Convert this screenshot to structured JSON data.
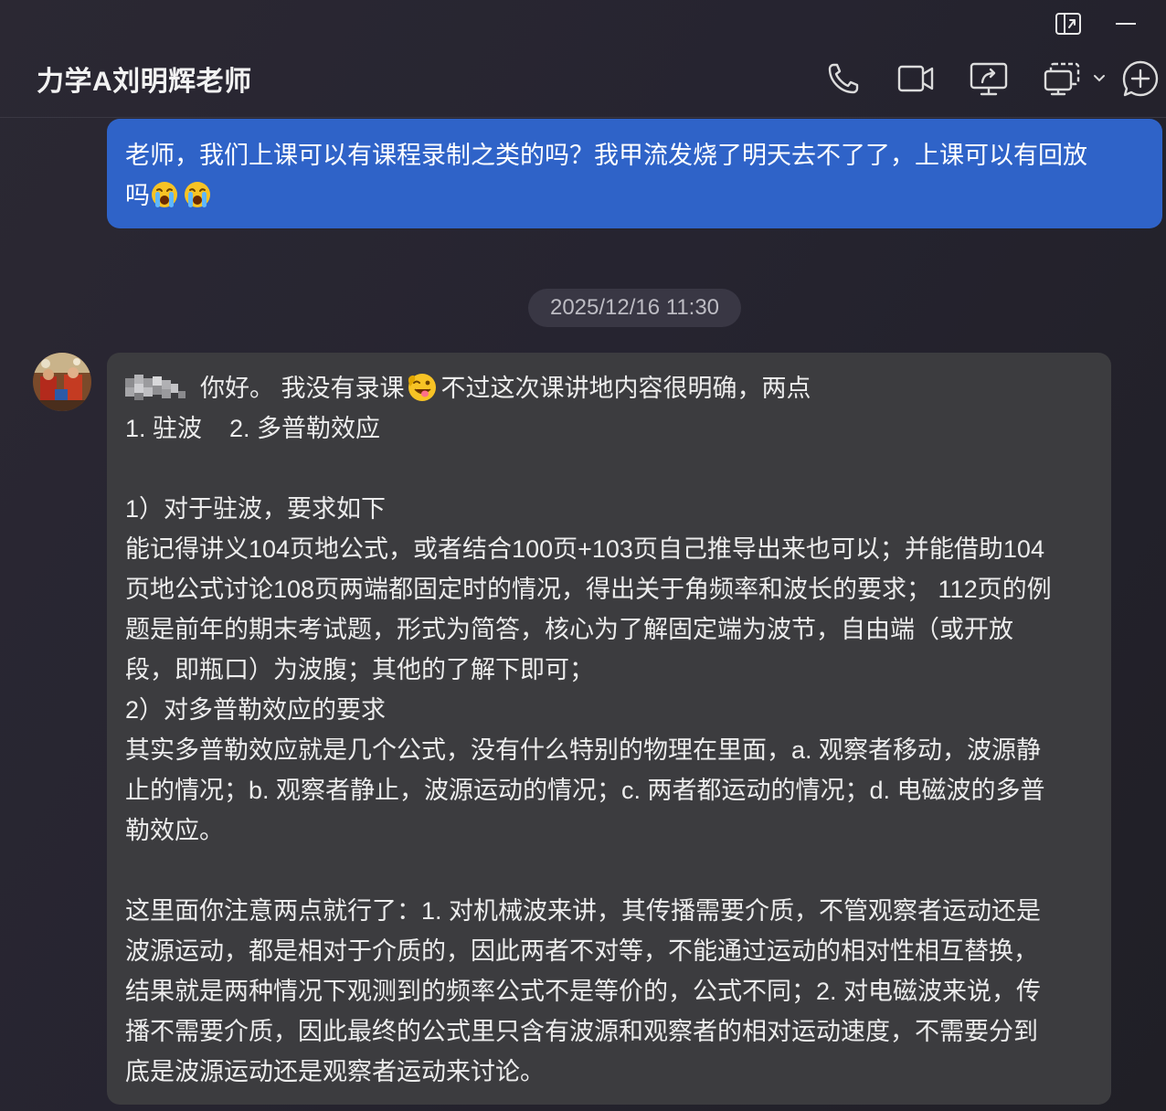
{
  "window": {
    "controls": [
      {
        "name": "pin-window-icon"
      },
      {
        "name": "minimize-icon"
      }
    ]
  },
  "header": {
    "title": "力学A刘明辉老师",
    "actions": [
      {
        "name": "voice-call-icon"
      },
      {
        "name": "video-call-icon"
      },
      {
        "name": "share-screen-icon"
      },
      {
        "name": "remote-assist-icon"
      },
      {
        "name": "chevron-down-icon"
      },
      {
        "name": "add-chat-icon"
      }
    ]
  },
  "messages": {
    "outgoing": {
      "line1": "老师，我们上课可以有课程录制之类的吗？我甲流发烧了明天去不了了，上课可以有回放",
      "line2_text": "吗",
      "emojis": [
        "loudly-crying-emoji",
        "loudly-crying-emoji"
      ]
    },
    "timestamp": "2025/12/16 11:30",
    "incoming": {
      "greeting": "你好。 我没有录课",
      "greeting_rest": "不过这次课讲地内容很明确，两点",
      "lines": [
        "1. 驻波    2. 多普勒效应",
        "",
        "1）对于驻波，要求如下",
        "能记得讲义104页地公式，或者结合100页+103页自己推导出来也可以；并能借助104",
        "页地公式讨论108页两端都固定时的情况，得出关于角频率和波长的要求； 112页的例",
        "题是前年的期末考试题，形式为简答，核心为了解固定端为波节，自由端（或开放",
        "段，即瓶口）为波腹；其他的了解下即可；",
        "2）对多普勒效应的要求",
        "其实多普勒效应就是几个公式，没有什么特别的物理在里面，a. 观察者移动，波源静",
        "止的情况；b. 观察者静止，波源运动的情况；c. 两者都运动的情况；d. 电磁波的多普",
        "勒效应。",
        "",
        "这里面你注意两点就行了：1. 对机械波来讲，其传播需要介质，不管观察者运动还是",
        "波源运动，都是相对于介质的，因此两者不对等，不能通过运动的相对性相互替换，",
        "结果就是两种情况下观测到的频率公式不是等价的，公式不同；2. 对电磁波来说，传",
        "播不需要介质，因此最终的公式里只含有波源和观察者的相对运动速度，不需要分到",
        "底是波源运动还是观察者运动来讨论。"
      ]
    }
  },
  "colors": {
    "outgoing_bubble": "#2f63c8",
    "incoming_bubble": "#3c3c3f",
    "background": "#26242d",
    "timestamp_pill": "#393744"
  }
}
